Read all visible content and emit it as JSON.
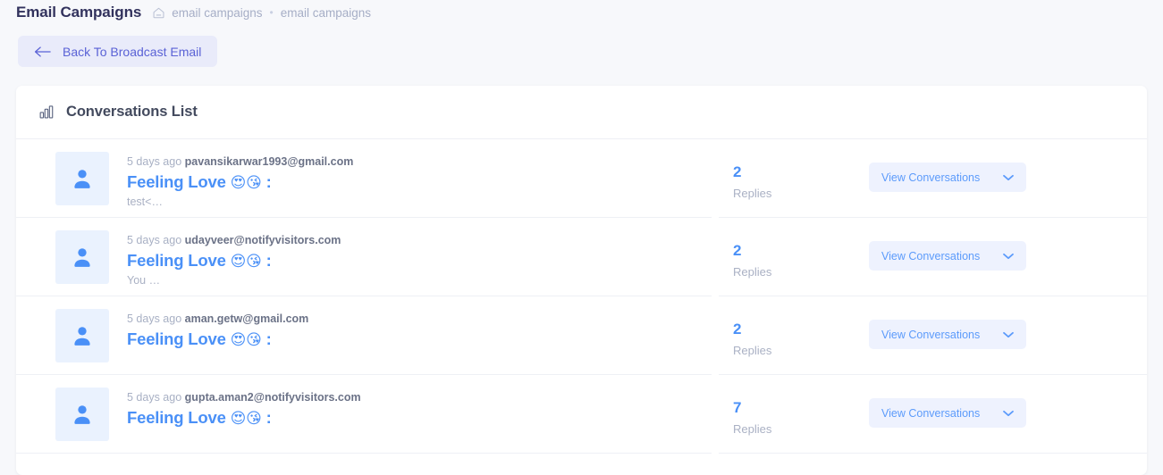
{
  "header": {
    "title": "Email Campaigns",
    "home_icon": "home-icon",
    "breadcrumb": [
      "email campaigns",
      "email campaigns"
    ],
    "separator": "•"
  },
  "toolbar": {
    "back_label": "Back To Broadcast Email",
    "back_icon": "arrow-left-icon"
  },
  "card": {
    "icon": "bar-chart-icon",
    "title": "Conversations List"
  },
  "colors": {
    "page_bg": "#f7f8fb",
    "accent_blue": "#4a90f7",
    "back_btn_bg": "#e9ebfa",
    "back_btn_text": "#5a62d6",
    "view_btn_bg": "#eef2fe",
    "avatar_bg": "#eaf2fe"
  },
  "conversations": [
    {
      "avatar_icon": "person-icon",
      "time": "5 days ago",
      "email": "pavansikarwar1993@gmail.com",
      "subject": "Feeling Love",
      "emoji": "😍😘",
      "colon": ":",
      "preview": "test<…",
      "replies_count": "2",
      "replies_label": "Replies",
      "action_label": "View Conversations",
      "action_icon": "chevron-down-icon"
    },
    {
      "avatar_icon": "person-icon",
      "time": "5 days ago",
      "email": "udayveer@notifyvisitors.com",
      "subject": "Feeling Love",
      "emoji": "😍😘",
      "colon": ":",
      "preview": "You …",
      "replies_count": "2",
      "replies_label": "Replies",
      "action_label": "View Conversations",
      "action_icon": "chevron-down-icon"
    },
    {
      "avatar_icon": "person-icon",
      "time": "5 days ago",
      "email": "aman.getw@gmail.com",
      "subject": "Feeling Love",
      "emoji": "😍😘",
      "colon": ":",
      "preview": "",
      "replies_count": "2",
      "replies_label": "Replies",
      "action_label": "View Conversations",
      "action_icon": "chevron-down-icon"
    },
    {
      "avatar_icon": "person-icon",
      "time": "5 days ago",
      "email": "gupta.aman2@notifyvisitors.com",
      "subject": "Feeling Love",
      "emoji": "😍😘",
      "colon": ":",
      "preview": "",
      "replies_count": "7",
      "replies_label": "Replies",
      "action_label": "View Conversations",
      "action_icon": "chevron-down-icon"
    }
  ]
}
